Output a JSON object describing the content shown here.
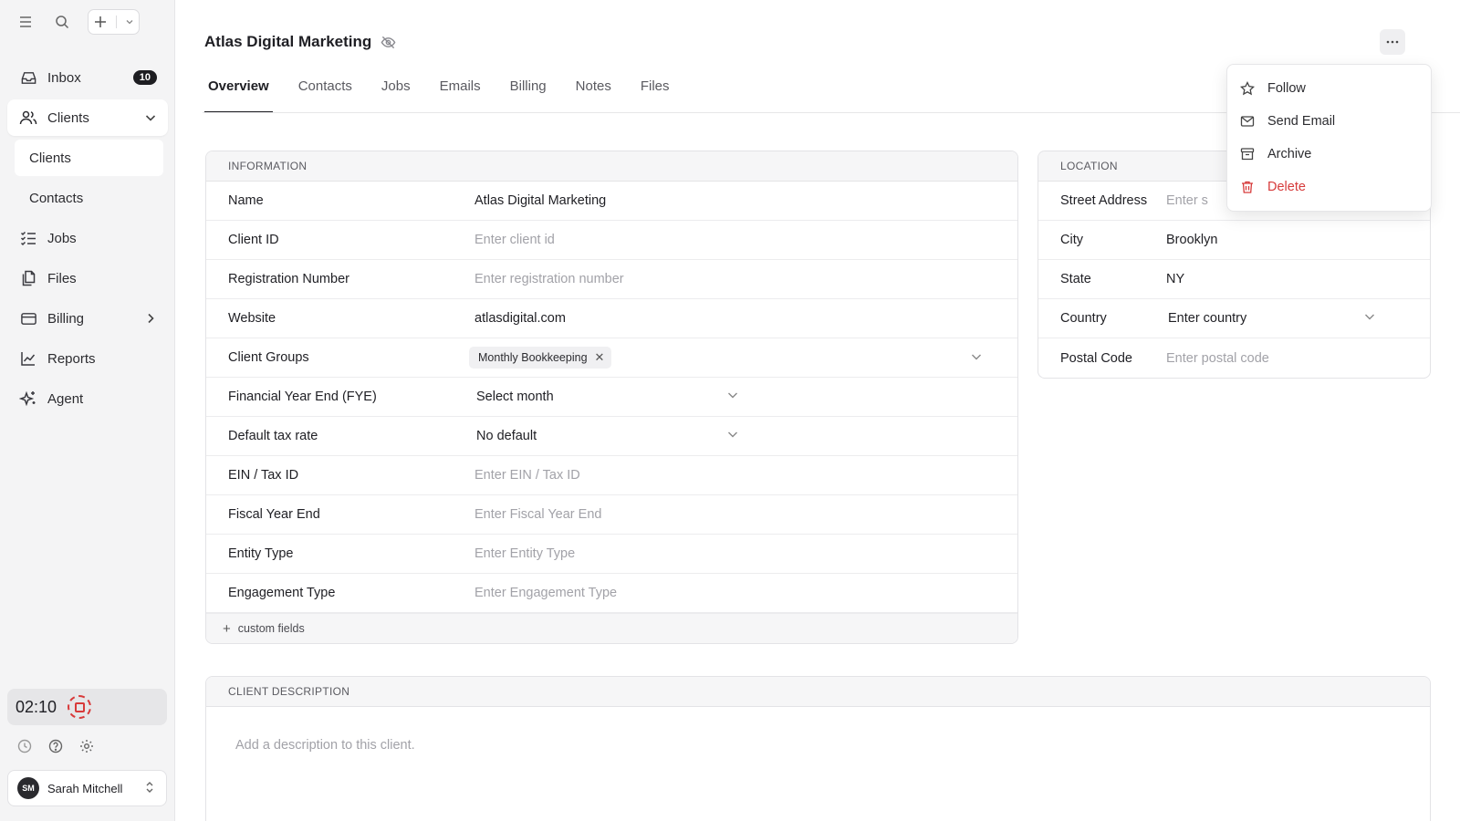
{
  "sidebar": {
    "nav": {
      "inbox": "Inbox",
      "inbox_count": "10",
      "clients": "Clients",
      "clients_sub": [
        "Clients",
        "Contacts"
      ],
      "jobs": "Jobs",
      "files": "Files",
      "billing": "Billing",
      "reports": "Reports",
      "agent": "Agent"
    },
    "timer": "02:10",
    "user": {
      "initials": "SM",
      "name": "Sarah Mitchell"
    }
  },
  "header": {
    "title": "Atlas Digital Marketing",
    "tabs": [
      "Overview",
      "Contacts",
      "Jobs",
      "Emails",
      "Billing",
      "Notes",
      "Files"
    ]
  },
  "menu": {
    "items": [
      "Follow",
      "Send Email",
      "Archive",
      "Delete"
    ]
  },
  "information": {
    "heading": "INFORMATION",
    "rows": [
      {
        "label": "Name",
        "value": "Atlas Digital Marketing"
      },
      {
        "label": "Client ID",
        "placeholder": "Enter client id"
      },
      {
        "label": "Registration Number",
        "placeholder": "Enter registration number"
      },
      {
        "label": "Website",
        "value": "atlasdigital.com"
      },
      {
        "label": "Client Groups",
        "chip": "Monthly Bookkeeping"
      },
      {
        "label": "Financial Year End (FYE)",
        "select": "Select month"
      },
      {
        "label": "Default tax rate",
        "select": "No default"
      },
      {
        "label": "EIN / Tax ID",
        "placeholder": "Enter EIN / Tax ID"
      },
      {
        "label": "Fiscal Year End",
        "placeholder": "Enter Fiscal Year End"
      },
      {
        "label": "Entity Type",
        "placeholder": "Enter Entity Type"
      },
      {
        "label": "Engagement Type",
        "placeholder": "Enter Engagement Type"
      }
    ],
    "custom_fields": "custom fields"
  },
  "location": {
    "heading": "LOCATION",
    "rows": [
      {
        "label": "Street Address",
        "placeholder": "Enter s"
      },
      {
        "label": "City",
        "value": "Brooklyn"
      },
      {
        "label": "State",
        "value": "NY"
      },
      {
        "label": "Country",
        "select": "Enter country"
      },
      {
        "label": "Postal Code",
        "placeholder": "Enter postal code"
      }
    ]
  },
  "description": {
    "heading": "CLIENT DESCRIPTION",
    "placeholder": "Add a description to this client."
  },
  "colors": {
    "accent": "#1e1e22",
    "danger": "#d63a3a",
    "timer": "#d83a3a"
  }
}
